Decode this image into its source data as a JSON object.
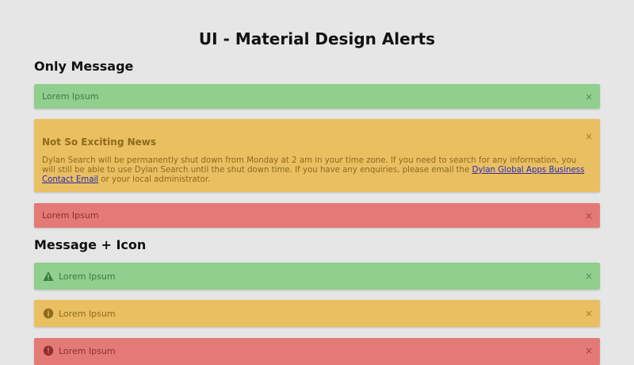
{
  "page": {
    "title": "UI - Material Design Alerts"
  },
  "sections": [
    {
      "heading": "Only Message"
    },
    {
      "heading": "Message + Icon"
    }
  ],
  "only_message": {
    "success": {
      "text": "Lorem Ipsum",
      "close": "×"
    },
    "warning": {
      "title": "Not So Exciting News",
      "body_before_link": "Dylan Search will be permanently shut down from Monday at 2 am in your time zone. If you need to search for any information, you will still be able to use Dylan Search until the shut down time. If you have any enquiries, please email the ",
      "link_text": "Dylan Global Apps Business Contact Email",
      "body_after_link": " or your local administrator.",
      "close": "×"
    },
    "danger": {
      "text": "Lorem Ipsum",
      "close": "×"
    }
  },
  "message_icon": {
    "success": {
      "text": "Lorem Ipsum",
      "icon": "warning-triangle-icon",
      "close": "×"
    },
    "warning": {
      "text": "Lorem Ipsum",
      "icon": "info-circle-icon",
      "close": "×"
    },
    "danger": {
      "text": "Lorem Ipsum",
      "icon": "error-circle-icon",
      "close": "×"
    }
  },
  "colors": {
    "success": "#90cf8e",
    "warning": "#e9bf62",
    "danger": "#e37a76",
    "background": "#e6e6e6"
  }
}
